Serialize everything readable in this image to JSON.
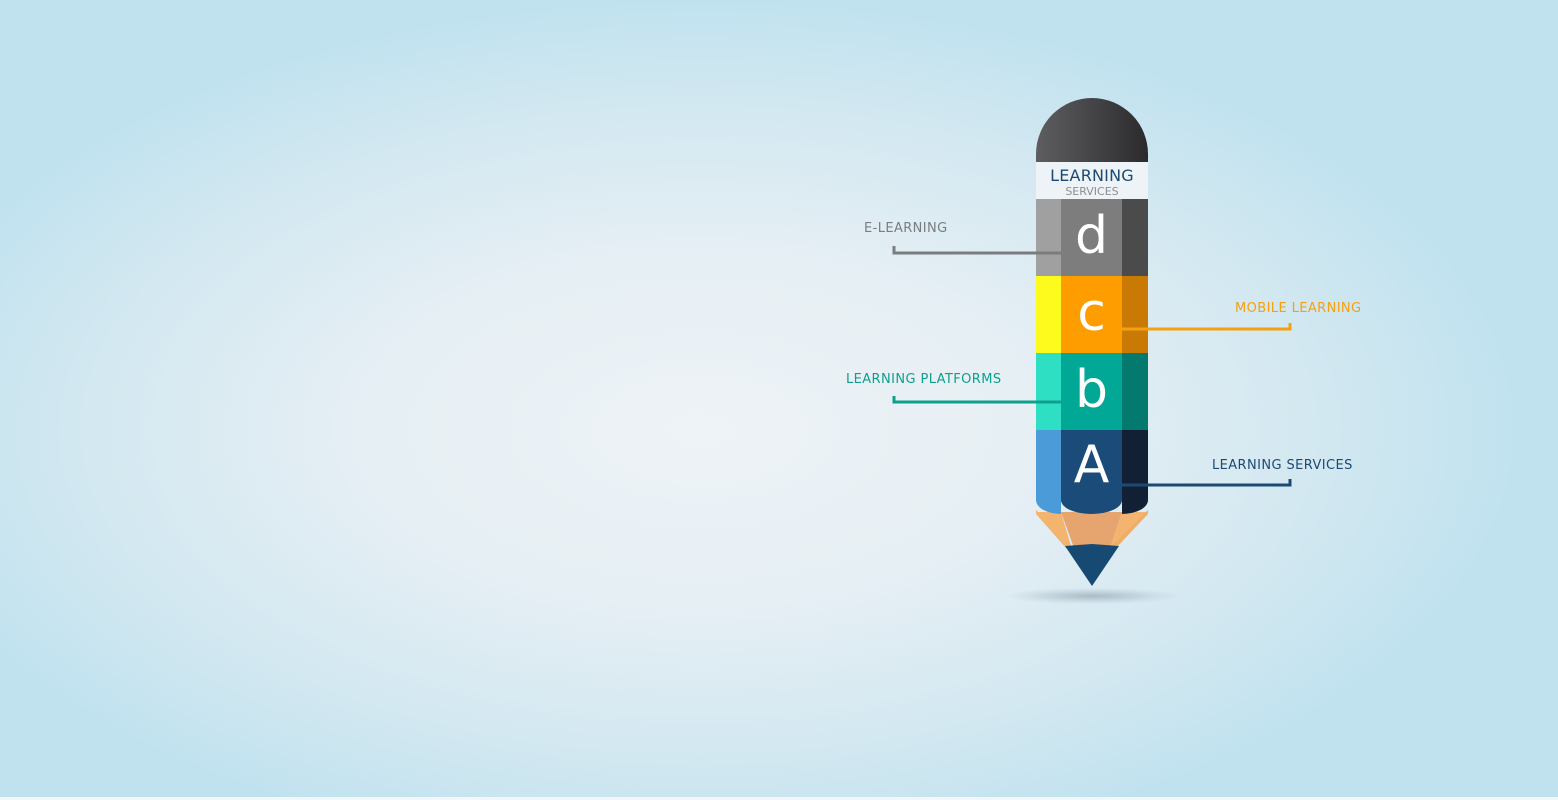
{
  "pencil": {
    "band_title": "LEARNING",
    "band_subtitle": "SERVICES",
    "segments": [
      {
        "letter": "d",
        "label": "E-LEARNING",
        "colors": {
          "left": "#a0a0a0",
          "mid": "#7d7d7d",
          "right": "#4b4b4b",
          "label": "#7a7d80"
        }
      },
      {
        "letter": "c",
        "label": "MOBILE LEARNING",
        "colors": {
          "left": "#fdfb1e",
          "mid": "#fe9d00",
          "right": "#c97a05",
          "label": "#f5a011"
        }
      },
      {
        "letter": "b",
        "label": "LEARNING PLATFORMS",
        "colors": {
          "left": "#2fdfc3",
          "mid": "#00a895",
          "right": "#047a6e",
          "label": "#0f9f8d"
        }
      },
      {
        "letter": "A",
        "label": "LEARNING SERVICES",
        "colors": {
          "left": "#4a9bd8",
          "mid": "#1b4b79",
          "right": "#122036",
          "label": "#1c4a73"
        }
      }
    ],
    "tip_colors": {
      "wood_light": "#f2b46e",
      "wood_mid": "#e6a46e",
      "lead": "#164a73"
    }
  }
}
